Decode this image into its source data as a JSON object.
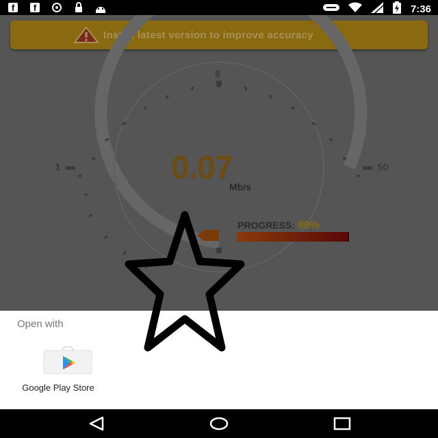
{
  "status_bar": {
    "time": "7:36",
    "left_icons": [
      "facebook-icon",
      "facebook-icon",
      "location-icon",
      "lock-icon",
      "android-icon"
    ],
    "right_icons": [
      "toggle-icon",
      "wifi-icon",
      "signal-icon",
      "battery-charging-icon"
    ]
  },
  "banner": {
    "text": "Install latest version to improve accuracy",
    "icon": "warning-icon",
    "color": "#8a6a10"
  },
  "gauge": {
    "scale_top": "8",
    "scale_left": "1",
    "scale_right": "50",
    "speed_value": "0.07",
    "speed_unit": "Mb/s"
  },
  "progress": {
    "label": "PROGRESS:",
    "value_text": "99%",
    "value": 0.99,
    "color": "#8a3a0a"
  },
  "sheet": {
    "title": "Open with",
    "apps": [
      {
        "label": "Google Play Store",
        "icon": "play-store-icon"
      }
    ]
  },
  "nav_bar": {
    "buttons": [
      "back-icon",
      "home-icon",
      "recents-icon"
    ]
  }
}
